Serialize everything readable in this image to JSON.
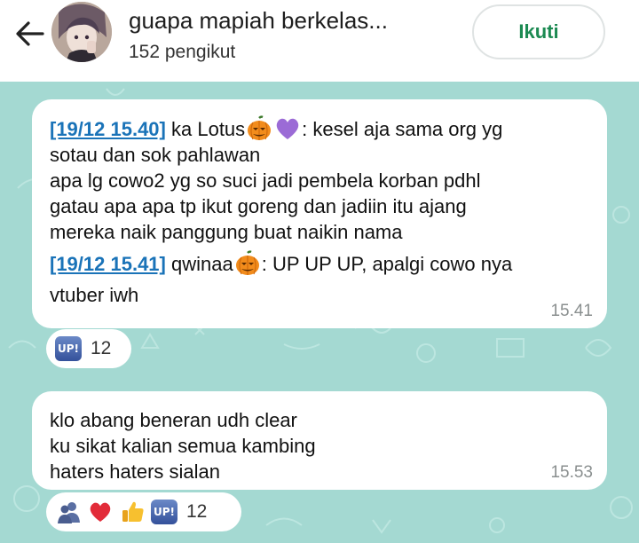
{
  "channel": {
    "title": "guapa mapiah berkelas...",
    "followers": "152 pengikut",
    "follow_label": "Ikuti"
  },
  "messages": [
    {
      "lines": [
        {
          "stamp": "[19/12 15.40]",
          "pre": "ka Lotus",
          "post": ": kesel aja sama org yg"
        },
        {
          "text": "sotau dan sok pahlawan"
        },
        {
          "text": "apa lg cowo2 yg so suci jadi pembela korban pdhl"
        },
        {
          "text": "gatau apa apa tp ikut goreng dan jadiin itu ajang"
        },
        {
          "text": "mereka naik panggung buat naikin nama"
        },
        {
          "stamp": "[19/12 15.41]",
          "pre": "qwinaa",
          "post": ": UP UP UP, apalgi cowo nya"
        },
        {
          "text": "vtuber iwh"
        }
      ],
      "time": "15.41",
      "reactions": {
        "icons": [
          "up-badge"
        ],
        "count": "12"
      }
    },
    {
      "lines": [
        {
          "text": "klo abang beneran udh clear"
        },
        {
          "text": "ku sikat kalian semua kambing"
        },
        {
          "text": "haters haters sialan"
        }
      ],
      "time": "15.53",
      "reactions": {
        "icons": [
          "people-icon",
          "heart-icon",
          "thumbs-up-icon",
          "up-badge"
        ],
        "count": "12"
      }
    }
  ],
  "badge_text": "UP!",
  "colors": {
    "follow_text": "#1c8a52",
    "chat_background": "#a4d9d2",
    "timestamp_link": "#1a73b8"
  }
}
